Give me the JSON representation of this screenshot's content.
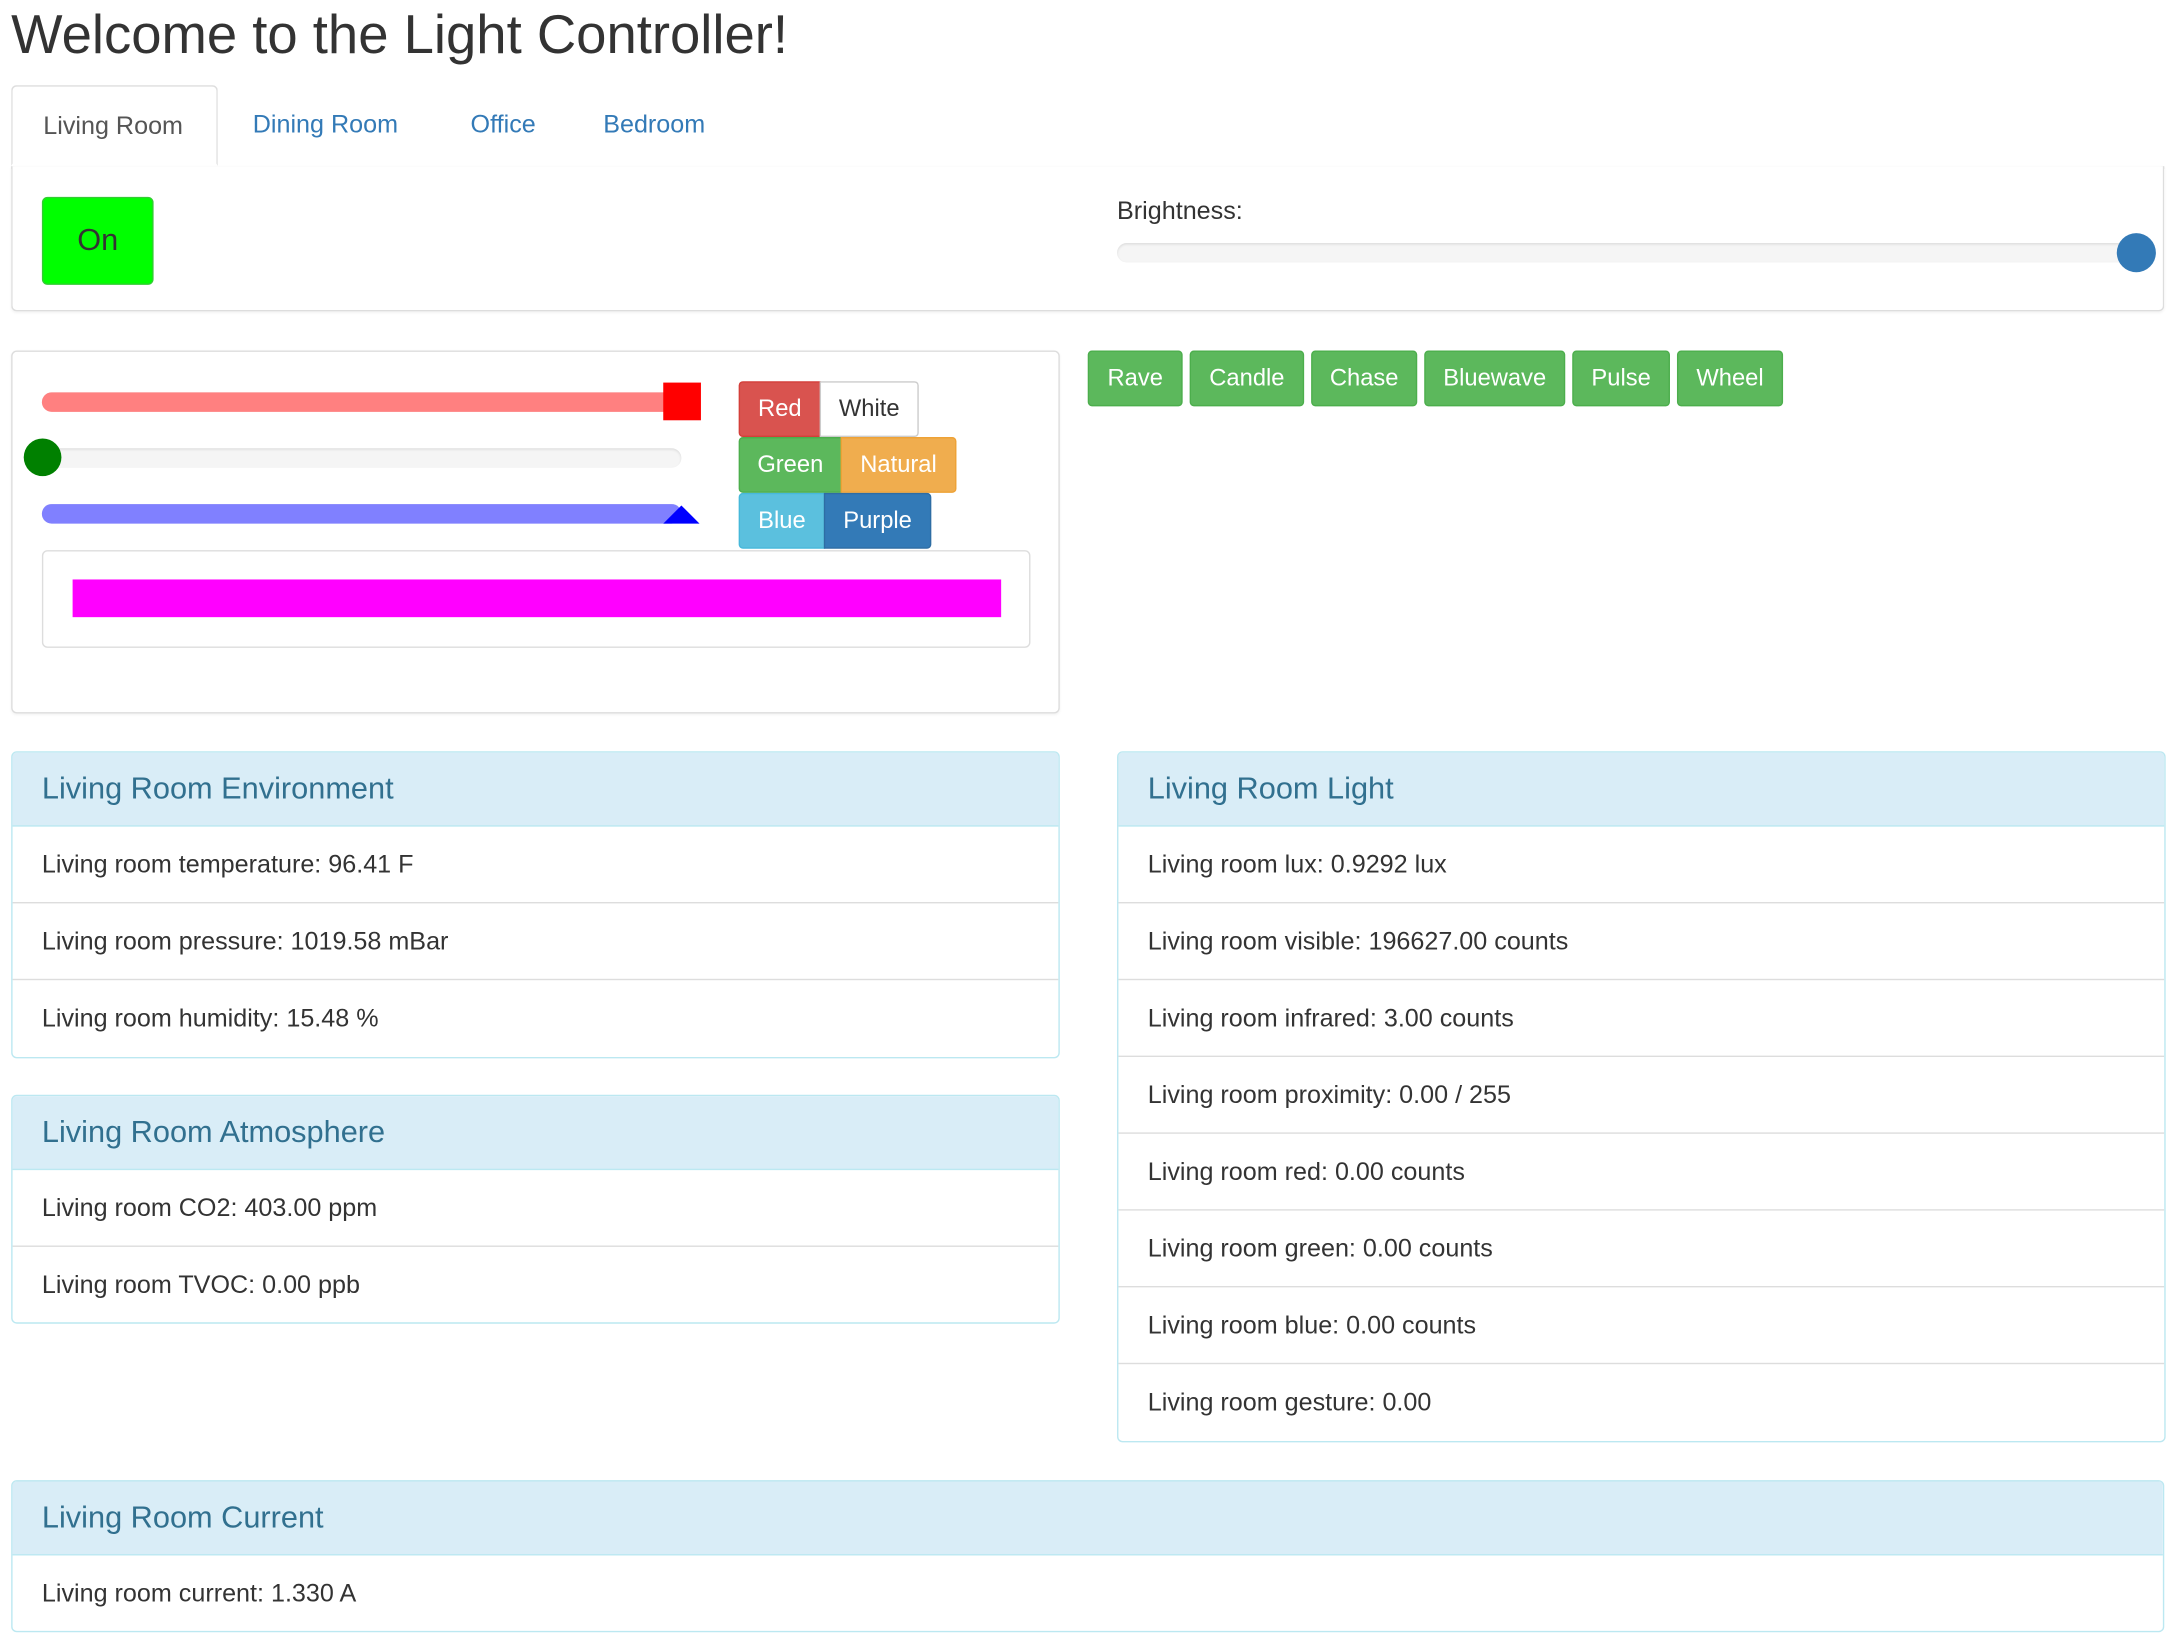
{
  "header": {
    "title": "Welcome to the Light Controller!"
  },
  "tabs": [
    {
      "label": "Living Room",
      "active": true
    },
    {
      "label": "Dining Room",
      "active": false
    },
    {
      "label": "Office",
      "active": false
    },
    {
      "label": "Bedroom",
      "active": false
    }
  ],
  "power": {
    "label": "On",
    "color": "#00ff00"
  },
  "brightness": {
    "label": "Brightness:",
    "value_fraction": 1.0
  },
  "color_sliders": {
    "red": 255,
    "green": 0,
    "blue": 255,
    "max": 255
  },
  "color_buttons": {
    "red": "Red",
    "white": "White",
    "green": "Green",
    "natural": "Natural",
    "blue": "Blue",
    "purple": "Purple"
  },
  "preview_color": "#ff00ff",
  "effects": [
    "Rave",
    "Candle",
    "Chase",
    "Bluewave",
    "Pulse",
    "Wheel"
  ],
  "environment": {
    "title": "Living Room Environment",
    "rows": [
      "Living room temperature: 96.41 F",
      "Living room pressure: 1019.58 mBar",
      "Living room humidity: 15.48 %"
    ]
  },
  "atmosphere": {
    "title": "Living Room Atmosphere",
    "rows": [
      "Living room CO2: 403.00 ppm",
      "Living room TVOC: 0.00 ppb"
    ]
  },
  "light": {
    "title": "Living Room Light",
    "rows": [
      "Living room lux: 0.9292 lux",
      "Living room visible: 196627.00 counts",
      "Living room infrared: 3.00 counts",
      "Living room proximity: 0.00 / 255",
      "Living room red: 0.00 counts",
      "Living room green: 0.00 counts",
      "Living room blue: 0.00 counts",
      "Living room gesture: 0.00"
    ]
  },
  "current": {
    "title": "Living Room Current",
    "rows": [
      "Living room current: 1.330 A"
    ]
  }
}
